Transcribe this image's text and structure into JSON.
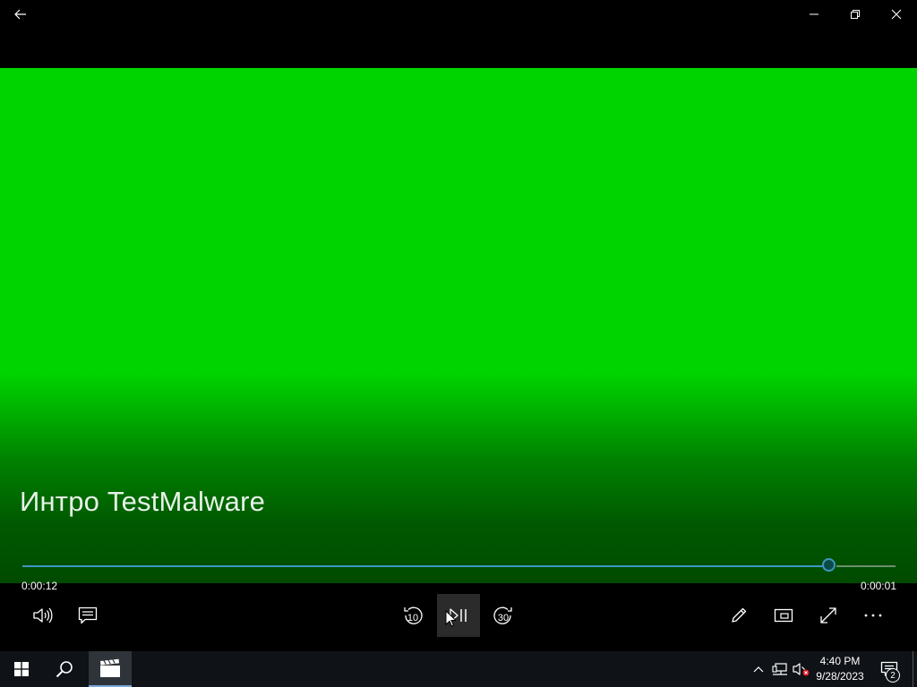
{
  "window": {
    "back_icon": "arrow-left-icon",
    "minimize_icon": "minimize-icon",
    "restore_icon": "restore-icon",
    "close_icon": "close-icon"
  },
  "video": {
    "title": "Интро TestMalware",
    "background_color": "#00d400",
    "progress_fraction": 0.924
  },
  "playback": {
    "elapsed": "0:00:12",
    "remaining": "0:00:01",
    "accent_color": "#3c98c2"
  },
  "controls": {
    "left": [
      {
        "name": "volume",
        "icon": "speaker-icon"
      },
      {
        "name": "subtitles",
        "icon": "subtitles-icon"
      }
    ],
    "center": [
      {
        "name": "skip-back",
        "icon": "rewind-10-icon",
        "label": "10"
      },
      {
        "name": "play-pause",
        "icon": "play-pause-icon"
      },
      {
        "name": "skip-forward",
        "icon": "forward-30-icon",
        "label": "30"
      }
    ],
    "right": [
      {
        "name": "edit",
        "icon": "pencil-icon"
      },
      {
        "name": "mini-view",
        "icon": "mini-view-icon"
      },
      {
        "name": "fullscreen",
        "icon": "fullscreen-icon"
      },
      {
        "name": "more",
        "icon": "more-icon"
      }
    ]
  },
  "taskbar": {
    "start_icon": "windows-icon",
    "search_icon": "search-icon",
    "active_app_icon": "clapperboard-icon",
    "tray": {
      "chevron_icon": "chevron-up-icon",
      "network_icon": "network-icon",
      "volume_icon": "volume-muted-icon",
      "time": "4:40 PM",
      "date": "9/28/2023",
      "notification_count": "2"
    }
  }
}
